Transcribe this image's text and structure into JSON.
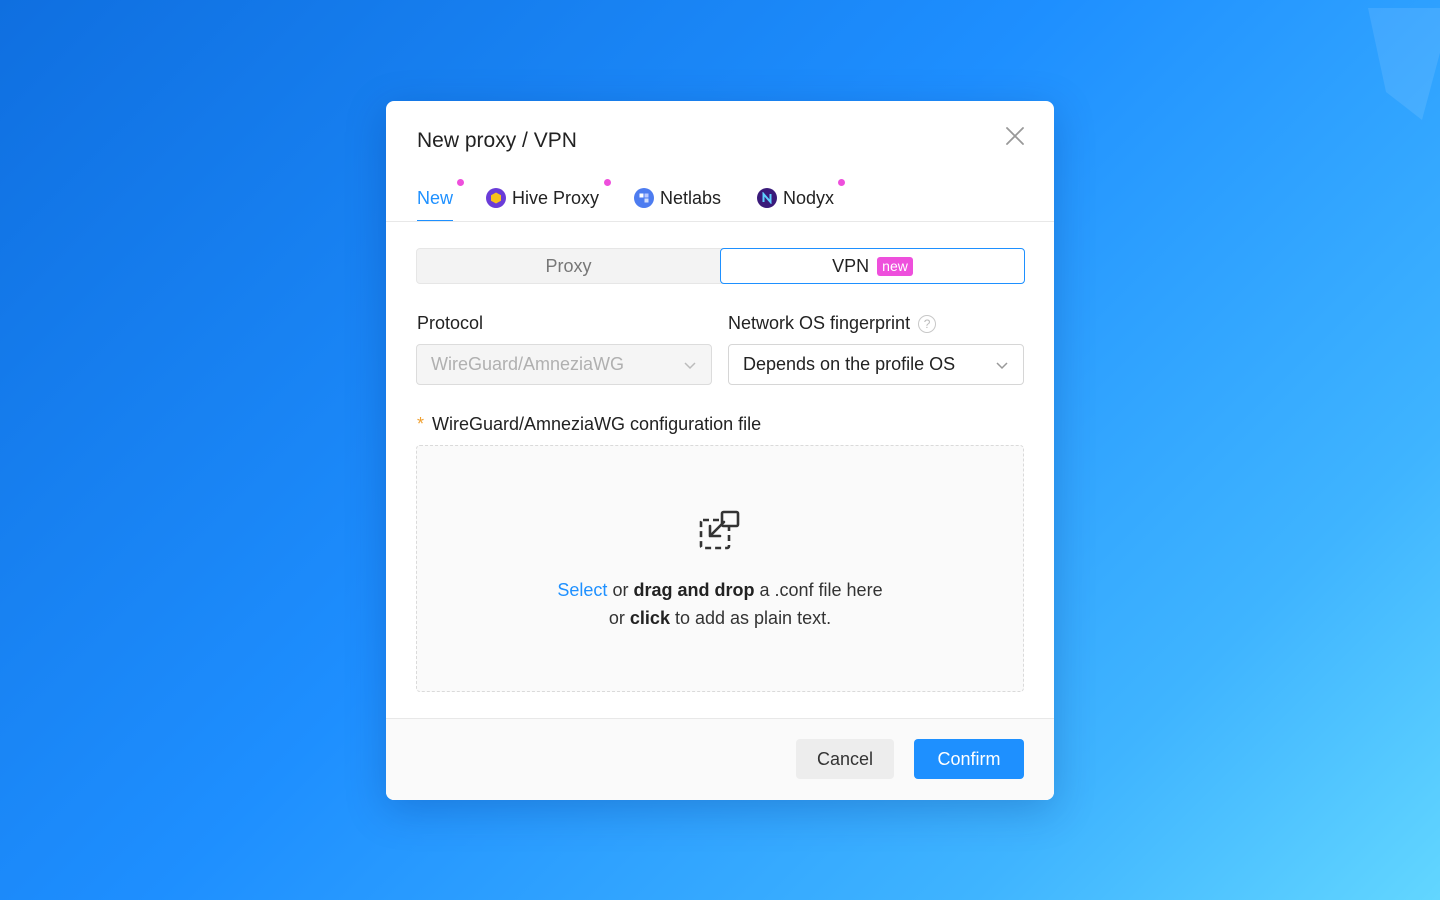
{
  "dialog": {
    "title": "New proxy / VPN",
    "close_icon": "close-icon"
  },
  "tabs": [
    {
      "label": "New",
      "active": true,
      "dot": true
    },
    {
      "label": "Hive Proxy",
      "icon": "hive-proxy-logo-icon",
      "dot": true
    },
    {
      "label": "Netlabs",
      "icon": "netlabs-logo-icon",
      "dot": false
    },
    {
      "label": "Nodyx",
      "icon": "nodyx-logo-icon",
      "dot": true
    }
  ],
  "mode": {
    "proxy_label": "Proxy",
    "vpn_label": "VPN",
    "vpn_badge": "new",
    "selected": "VPN"
  },
  "protocol": {
    "label": "Protocol",
    "value": "WireGuard/AmneziaWG",
    "disabled": true
  },
  "fingerprint": {
    "label": "Network OS fingerprint",
    "value": "Depends on the profile OS"
  },
  "config_file": {
    "required_mark": "*",
    "label": "WireGuard/AmneziaWG configuration file",
    "select_link": "Select",
    "text_or": "or",
    "drag_and_drop": "drag and drop",
    "text_file_here": "a .conf file here",
    "text_or2": "or",
    "click": "click",
    "text_plain": "to add as plain text."
  },
  "footer": {
    "cancel_label": "Cancel",
    "confirm_label": "Confirm"
  },
  "colors": {
    "accent": "#1e90ff",
    "badge": "#ee4fdc",
    "required": "#f0a030"
  }
}
